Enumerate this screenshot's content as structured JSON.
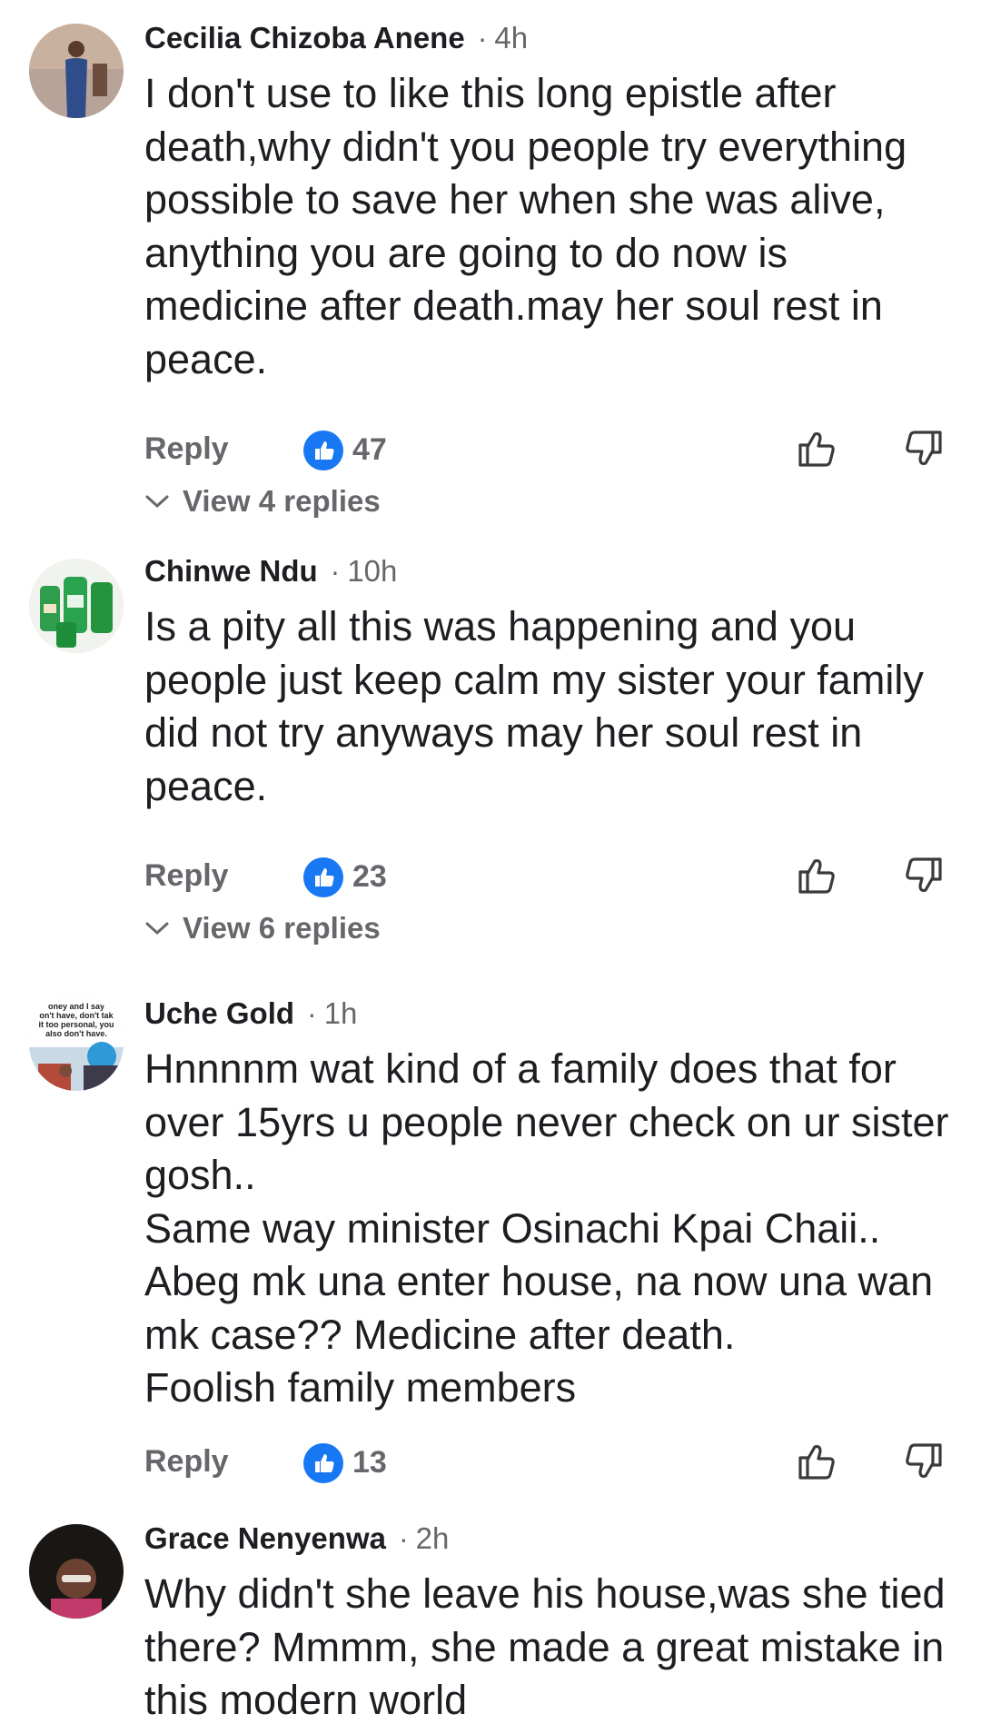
{
  "comments": [
    {
      "name": "Cecilia Chizoba Anene",
      "separator": "·",
      "time": "4h",
      "text": "I don't use to like this long epistle after\ndeath,why didn't you people try everything\npossible to save her when she was alive,\nanything you are going to do now is\nmedicine after death.may her soul rest in\npeace.",
      "reply_label": "Reply",
      "like_count": "47",
      "view_replies": "View 4 replies"
    },
    {
      "name": "Chinwe Ndu",
      "separator": "·",
      "time": "10h",
      "text": "Is a pity all this was happening and you\npeople just keep calm my sister your family\ndid not try anyways may her soul rest in\npeace.",
      "reply_label": "Reply",
      "like_count": "23",
      "view_replies": "View 6 replies"
    },
    {
      "name": "Uche Gold",
      "separator": "·",
      "time": "1h",
      "text": "Hnnnnm wat kind of a family does that for\nover 15yrs u people never check on ur sister\ngosh..\nSame way minister Osinachi Kpai Chaii..\nAbeg mk una enter house, na now una wan\nmk case?? Medicine after death.\nFoolish family members",
      "reply_label": "Reply",
      "like_count": "13",
      "avatar_text": "oney and I say\non't have, don't tak\nit too personal, you\nalso don't have."
    },
    {
      "name": "Grace Nenyenwa",
      "separator": "·",
      "time": "2h",
      "text": "Why didn't she leave his house,was she tied\nthere? Mmmm, she made a great mistake in\nthis modern world"
    }
  ],
  "colors": {
    "like_blue": "#1877f2",
    "secondary_text": "#65676b",
    "primary_text": "#1c1e21"
  },
  "icons": {
    "like_badge": "thumbs-up-badge-icon",
    "like": "thumbs-up-outline-icon",
    "dislike": "thumbs-down-outline-icon",
    "expand": "chevron-down-icon"
  }
}
